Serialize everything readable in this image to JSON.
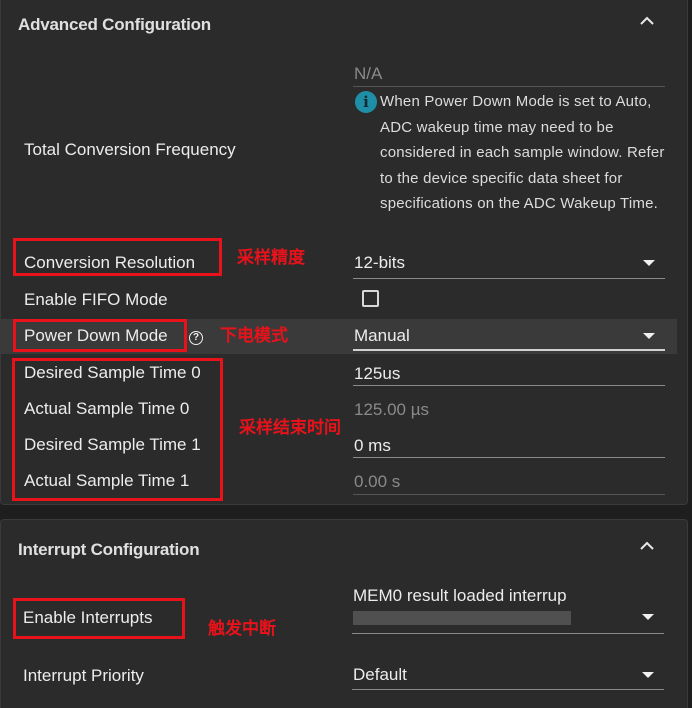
{
  "advanced": {
    "title": "Advanced Configuration",
    "total_conversion_frequency": {
      "label": "Total Conversion Frequency",
      "value": "N/A",
      "note": "When Power Down Mode is set to Auto, ADC wakeup time may need to be considered in each sample window. Refer to the device specific data sheet for specifications on the ADC Wakeup Time.",
      "note_icon": "info-icon"
    },
    "conversion_resolution": {
      "label": "Conversion Resolution",
      "value": "12-bits"
    },
    "enable_fifo": {
      "label": "Enable FIFO Mode",
      "checked": false
    },
    "power_down_mode": {
      "label": "Power Down Mode",
      "value": "Manual",
      "help_icon": "?"
    },
    "desired_sample_time_0": {
      "label": "Desired Sample Time 0",
      "value": "125us"
    },
    "actual_sample_time_0": {
      "label": "Actual Sample Time 0",
      "value": "125.00 µs"
    },
    "desired_sample_time_1": {
      "label": "Desired Sample Time 1",
      "value": "0 ms"
    },
    "actual_sample_time_1": {
      "label": "Actual Sample Time 1",
      "value": "0.00 s"
    }
  },
  "interrupt": {
    "title": "Interrupt Configuration",
    "enable_interrupts": {
      "label": "Enable Interrupts",
      "value": "MEM0 result loaded interrup"
    },
    "interrupt_priority": {
      "label": "Interrupt Priority",
      "value": "Default"
    }
  },
  "annotations": {
    "resolution": "采样精度",
    "power_down": "下电模式",
    "sample_time": "采样结束时间",
    "interrupts": "触发中断",
    "color": "#e8121b"
  },
  "colors": {
    "background": "#2b2b2b",
    "info_icon": "#1f8fa8",
    "highlight_row": "#3a3a3a"
  }
}
